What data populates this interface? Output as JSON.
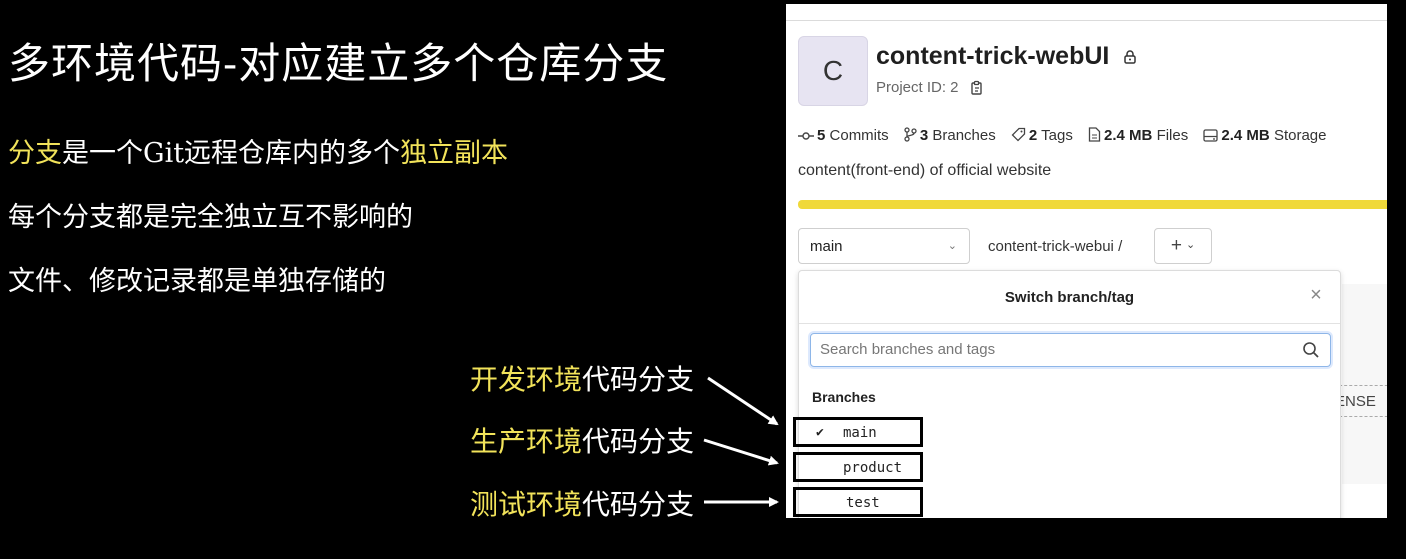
{
  "slide": {
    "title": "多环境代码-对应建立多个仓库分支",
    "line1": {
      "hl1": "分支",
      "mid": "是一个Git远程仓库内的多个",
      "hl2": "独立副本"
    },
    "line2": "每个分支都是完全独立互不影响的",
    "line3": "文件、修改记录都是单独存储的",
    "annotations": [
      {
        "hl": "开发环境",
        "rest": "代码分支"
      },
      {
        "hl": "生产环境",
        "rest": "代码分支"
      },
      {
        "hl": "测试环境",
        "rest": "代码分支"
      }
    ],
    "colors": {
      "highlight": "#f2e35a",
      "background": "#000000"
    }
  },
  "project": {
    "avatar_letter": "C",
    "name": "content-trick-webUI",
    "project_id": "Project ID: 2",
    "stats": [
      {
        "icon": "commit-icon",
        "count": "5",
        "label": "Commits"
      },
      {
        "icon": "branch-icon",
        "count": "3",
        "label": "Branches"
      },
      {
        "icon": "tag-icon",
        "count": "2",
        "label": "Tags"
      },
      {
        "icon": "file-icon",
        "count": "2.4 MB",
        "label": "Files"
      },
      {
        "icon": "storage-icon",
        "count": "2.4 MB",
        "label": "Storage"
      }
    ],
    "description": "content(front-end) of official website",
    "current_branch": "main",
    "path": "content-trick-webui",
    "path_sep": "/",
    "plus_label": "+",
    "license_partial": "ENSE"
  },
  "dropdown": {
    "title": "Switch branch/tag",
    "search_placeholder": "Search branches and tags",
    "section_label": "Branches",
    "branches": [
      {
        "name": "main",
        "selected": true
      },
      {
        "name": "product",
        "selected": false
      },
      {
        "name": "test",
        "selected": false
      }
    ]
  }
}
